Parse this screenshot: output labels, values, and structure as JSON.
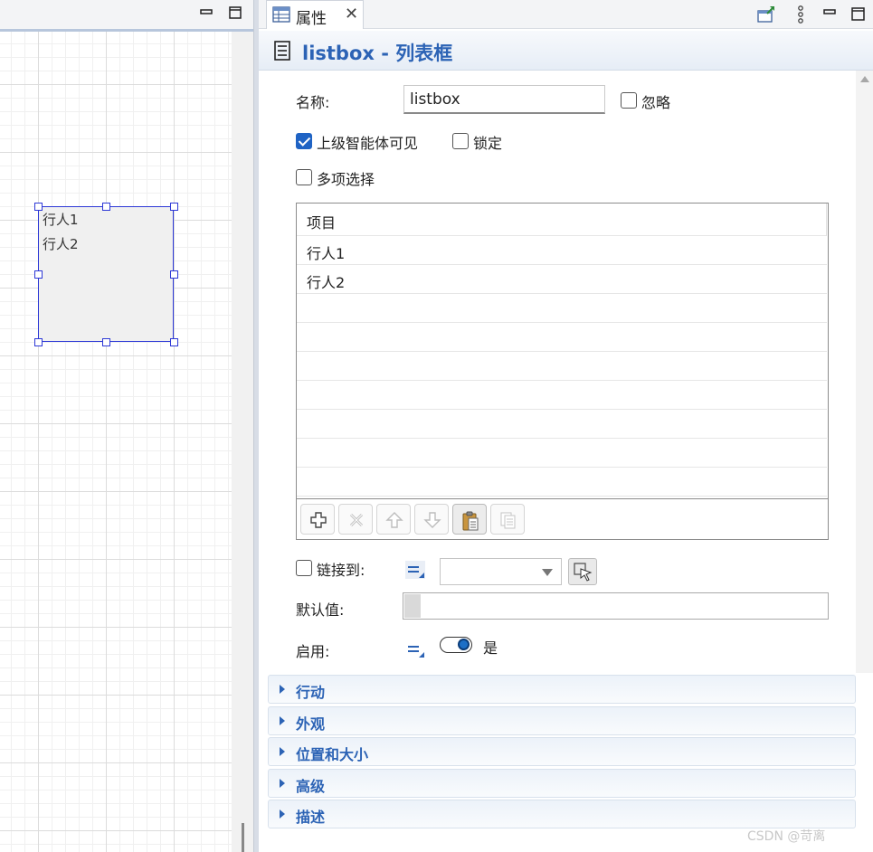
{
  "canvas": {
    "listbox_items": [
      "行人1",
      "行人2"
    ]
  },
  "tab": {
    "label": "属性"
  },
  "header": {
    "title": "listbox - 列表框"
  },
  "form": {
    "name_label": "名称:",
    "name_value": "listbox",
    "ignore_label": "忽略",
    "ignore_checked": false,
    "visible_label": "上级智能体可见",
    "visible_checked": true,
    "lock_label": "锁定",
    "lock_checked": false,
    "multi_label": "多项选择",
    "multi_checked": false,
    "table": {
      "header": "项目",
      "rows": [
        "行人1",
        "行人2"
      ]
    },
    "link_label": "链接到:",
    "link_checked": false,
    "default_label": "默认值:",
    "enabled_label": "启用:",
    "enabled_value": "是"
  },
  "sections": [
    "行动",
    "外观",
    "位置和大小",
    "高级",
    "描述"
  ],
  "watermark": "CSDN @苛离",
  "colors": {
    "accent": "#2c63b5",
    "selection": "#2d38d6",
    "checkbox_checked": "#1f63c4"
  }
}
